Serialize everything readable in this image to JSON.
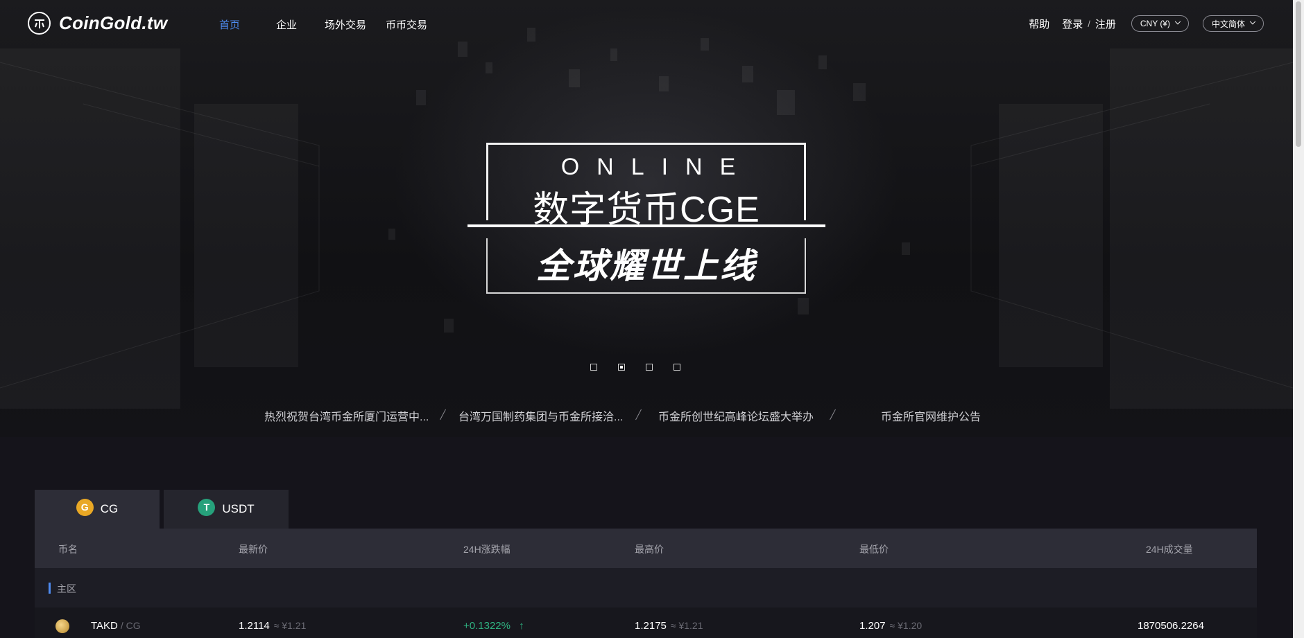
{
  "nav": {
    "logo_text": "CoinGold.tw",
    "menu": [
      {
        "label": "首页",
        "active": true
      },
      {
        "label": "企业",
        "active": false
      },
      {
        "label": "场外交易",
        "active": false
      },
      {
        "label": "币币交易",
        "active": false
      }
    ],
    "help": "帮助",
    "login": "登录",
    "separator": "/",
    "register": "注册",
    "currency": "CNY (¥)",
    "language": "中文简体"
  },
  "banner": {
    "online": "ONLINE",
    "headline": "数字货币CGE",
    "slogan": "全球耀世上线",
    "slide_count": 4,
    "active_slide": 2
  },
  "news": [
    "热烈祝贺台湾币金所厦门运营中...",
    "台湾万国制药集团与币金所接洽...",
    "币金所创世纪高峰论坛盛大举办",
    "币金所官网维护公告"
  ],
  "market": {
    "tabs": [
      {
        "label": "CG",
        "icon": "cg-coin-icon",
        "active": true
      },
      {
        "label": "USDT",
        "icon": "usdt-coin-icon",
        "active": false
      }
    ],
    "columns": [
      "币名",
      "最新价",
      "24H涨跌幅",
      "最高价",
      "最低价",
      "24H成交量"
    ],
    "zone_label": "主区",
    "rows": [
      {
        "coin": "TAKD",
        "pair": "/ CG",
        "last": "1.2114",
        "last_cny": "≈ ¥1.21",
        "change": "+0.1322%",
        "change_arrow": "↑",
        "high": "1.2175",
        "high_cny": "≈ ¥1.21",
        "low": "1.207",
        "low_cny": "≈ ¥1.20",
        "volume": "1870506.2264"
      }
    ]
  },
  "colors": {
    "accent": "#4e8bf0",
    "up": "#2fb482",
    "bg": "#15141b"
  }
}
